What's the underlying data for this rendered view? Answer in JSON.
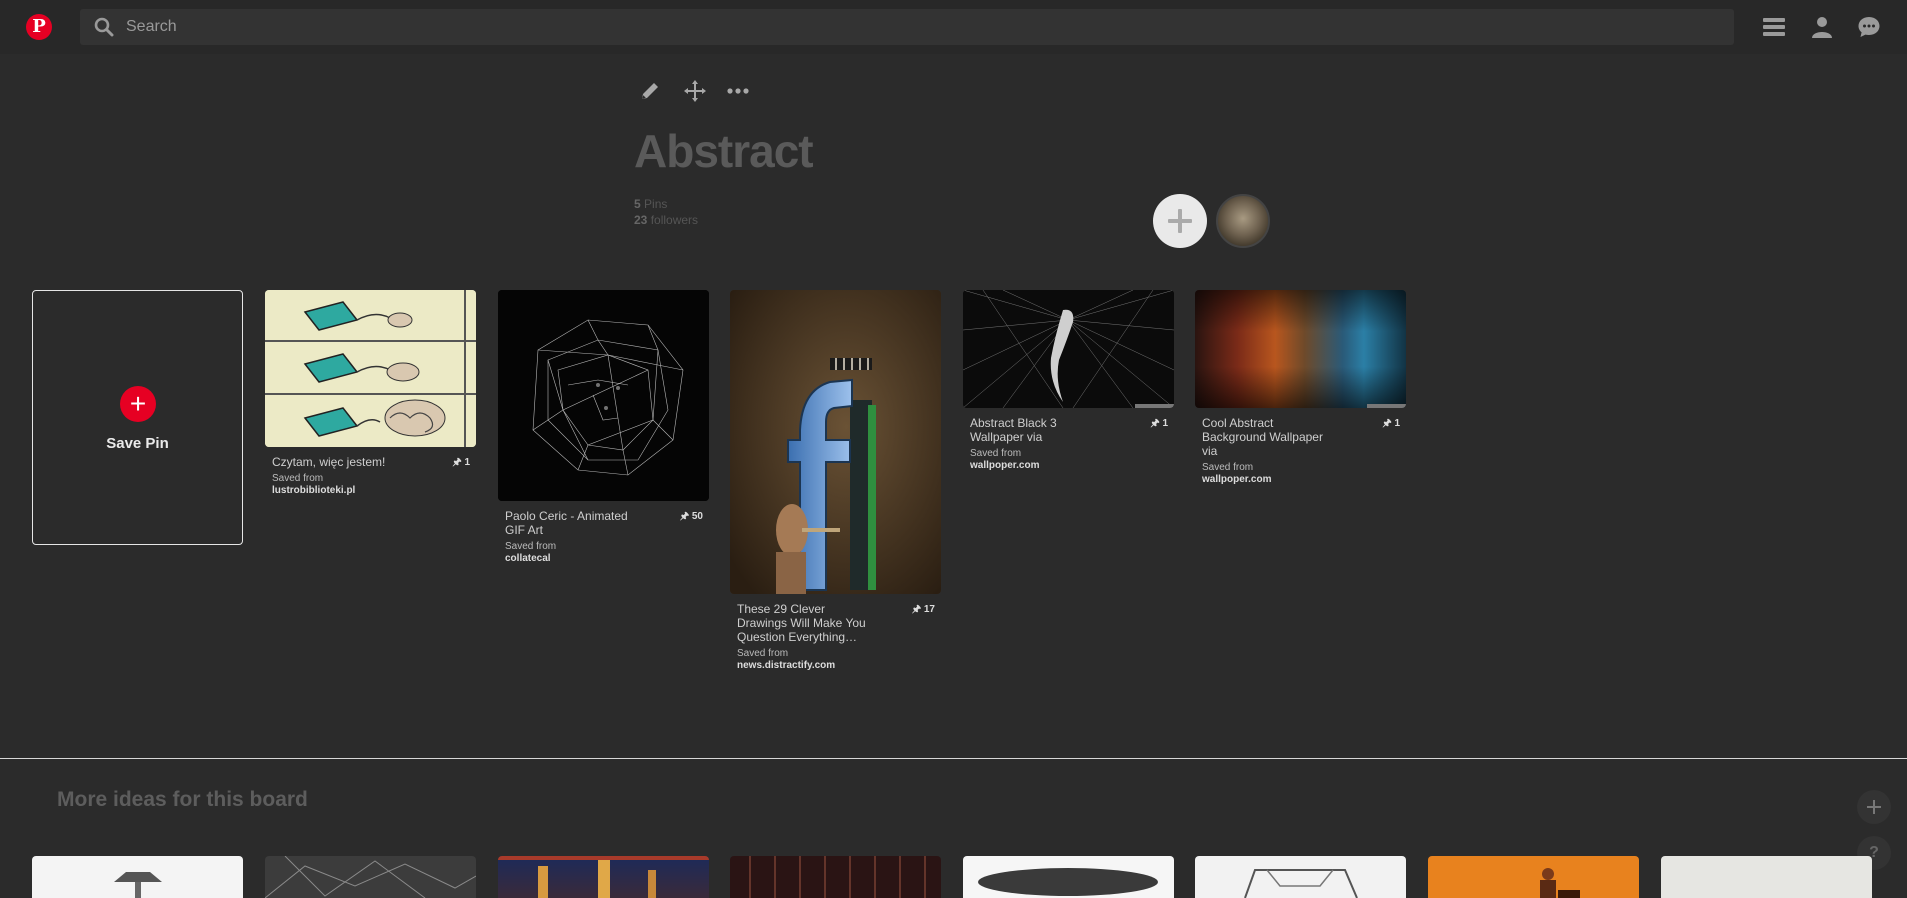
{
  "header": {
    "logo": "P",
    "search_placeholder": "Search"
  },
  "board": {
    "title": "Abstract",
    "pins_count": "5",
    "pins_label": "Pins",
    "followers_count": "23",
    "followers_label": "followers"
  },
  "save_pin": {
    "label": "Save Pin"
  },
  "pins": [
    {
      "title": "Czytam, więc jestem!",
      "count": "1",
      "saved_from": "Saved from",
      "source": "lustrobiblioteki.pl"
    },
    {
      "title": "Paolo Ceric - Animated GIF Art",
      "count": "50",
      "saved_from": "Saved from",
      "source": "collatecal"
    },
    {
      "title": "These 29 Clever Drawings Will Make You Question Everything…",
      "count": "17",
      "saved_from": "Saved from",
      "source": "news.distractify.com"
    },
    {
      "title": "Abstract Black 3 Wallpaper via",
      "count": "1",
      "saved_from": "Saved from",
      "source": "wallpoper.com"
    },
    {
      "title": "Cool Abstract Background Wallpaper via",
      "count": "1",
      "saved_from": "Saved from",
      "source": "wallpoper.com"
    }
  ],
  "more_ideas": {
    "title": "More ideas for this board",
    "help": "?"
  },
  "colors": {
    "brand": "#e60023",
    "background": "#2b2b2b"
  }
}
